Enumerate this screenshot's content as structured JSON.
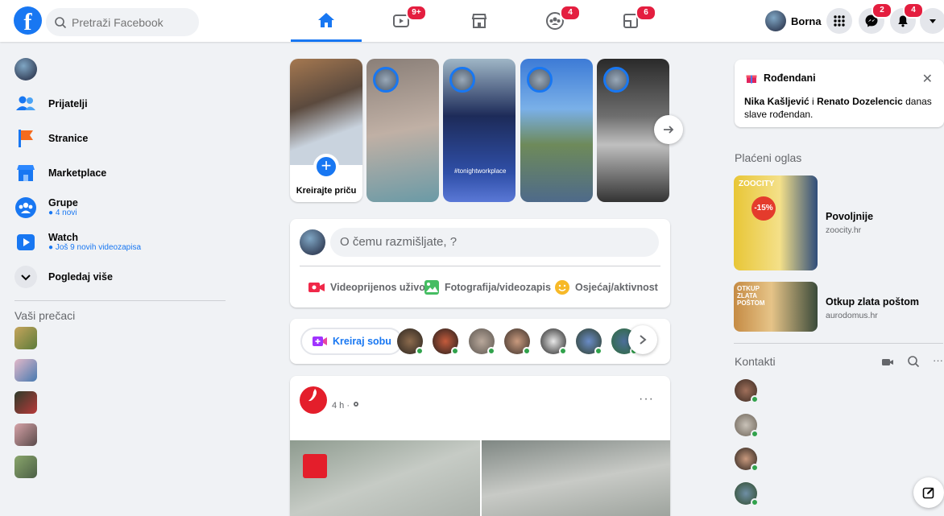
{
  "header": {
    "logo": "f",
    "search_placeholder": "Pretraži Facebook",
    "nav_tabs": [
      {
        "name": "home",
        "badge": ""
      },
      {
        "name": "watch",
        "badge": "9+"
      },
      {
        "name": "marketplace",
        "badge": ""
      },
      {
        "name": "groups",
        "badge": "4"
      },
      {
        "name": "gaming",
        "badge": "6"
      }
    ],
    "profile_name": "Borna",
    "messenger_badge": "2",
    "notifications_badge": "4",
    "brand_color": "#1877f2"
  },
  "sidebar": {
    "items": [
      {
        "label": "Prijatelji",
        "sub": "",
        "icon": "friends-icon"
      },
      {
        "label": "Stranice",
        "sub": "",
        "icon": "pages-flag-icon"
      },
      {
        "label": "Marketplace",
        "sub": "",
        "icon": "marketplace-icon"
      },
      {
        "label": "Grupe",
        "sub": "4 novi",
        "icon": "groups-icon"
      },
      {
        "label": "Watch",
        "sub": "Još 9 novih videozapisa",
        "icon": "watch-icon"
      }
    ],
    "see_more": "Pogledaj više",
    "shortcuts_title": "Vaši prečaci"
  },
  "stories": {
    "create_label": "Kreirajte priču",
    "story4_caption": "#tonightworkplace"
  },
  "composer": {
    "placeholder": "O čemu razmišljate,          ?",
    "actions": [
      "Videoprijenos uživo",
      "Fotografija/videozapis",
      "Osjećaj/aktivnost"
    ]
  },
  "rooms": {
    "create_label": "Kreiraj sobu"
  },
  "post": {
    "time": "4 h ·",
    "more": "···"
  },
  "right": {
    "birthdays_title": "Rođendani",
    "birthday_name1": "Nika Kašljević",
    "birthday_connector": " i ",
    "birthday_name2": "Renato Dozelencic",
    "birthday_text": " danas slave rođendan.",
    "sponsored_title": "Plaćeni oglas",
    "ads": [
      {
        "name": "Povoljnije",
        "url": "zoocity.hr",
        "brand": "ZOOCITY",
        "badge": "-15%"
      },
      {
        "name": "Otkup zlata poštom",
        "url": "aurodomus.hr",
        "brand": "OTKUP ZLATA POŠTOM"
      }
    ],
    "contacts_title": "Kontakti"
  }
}
